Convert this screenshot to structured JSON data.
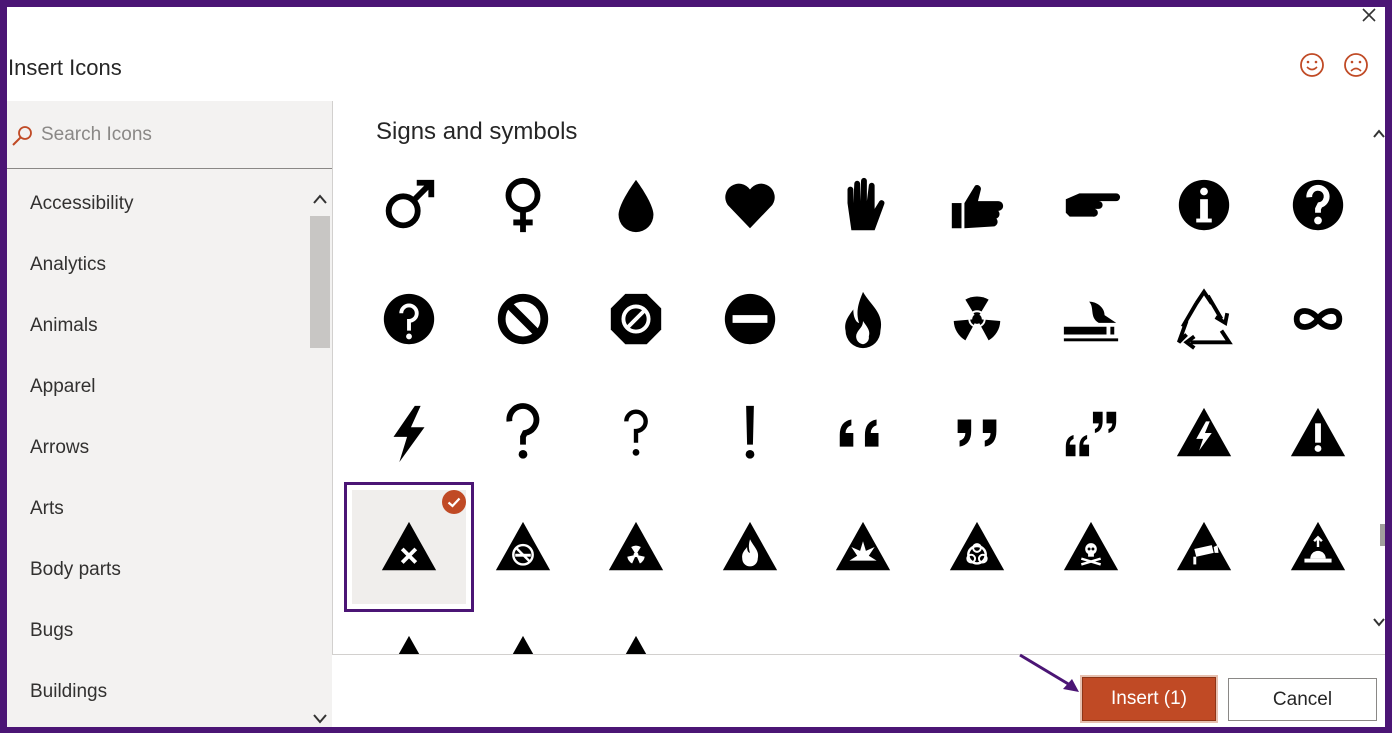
{
  "dialog": {
    "title": "Insert Icons"
  },
  "search": {
    "placeholder": "Search Icons"
  },
  "categories": [
    "Accessibility",
    "Analytics",
    "Animals",
    "Apparel",
    "Arrows",
    "Arts",
    "Body parts",
    "Bugs",
    "Buildings"
  ],
  "section": {
    "title": "Signs and symbols"
  },
  "icons": [
    "male-symbol",
    "female-symbol",
    "drop",
    "heart",
    "raised-hand",
    "thumbs-up",
    "hand-pointing-right",
    "information",
    "question-circle",
    "question-circle-alt",
    "prohibited",
    "octagon-prohibited",
    "no-entry",
    "fire",
    "radiation",
    "smoking",
    "recycle",
    "infinity",
    "lightning",
    "question-mark",
    "question-mark-alt",
    "exclamation-mark",
    "open-quote",
    "close-quote",
    "quote-marks",
    "warning-electricity",
    "warning-exclamation",
    "warning-x",
    "warning-no-smoking",
    "warning-radiation",
    "warning-flammable",
    "warning-explosive",
    "warning-biohazard",
    "warning-toxic",
    "warning-camera",
    "warning-hazard-level"
  ],
  "selected_icon": "warning-x",
  "buttons": {
    "insert": "Insert (1)",
    "cancel": "Cancel"
  },
  "colors": {
    "accent": "#c04a25",
    "frame": "#4b1575"
  }
}
